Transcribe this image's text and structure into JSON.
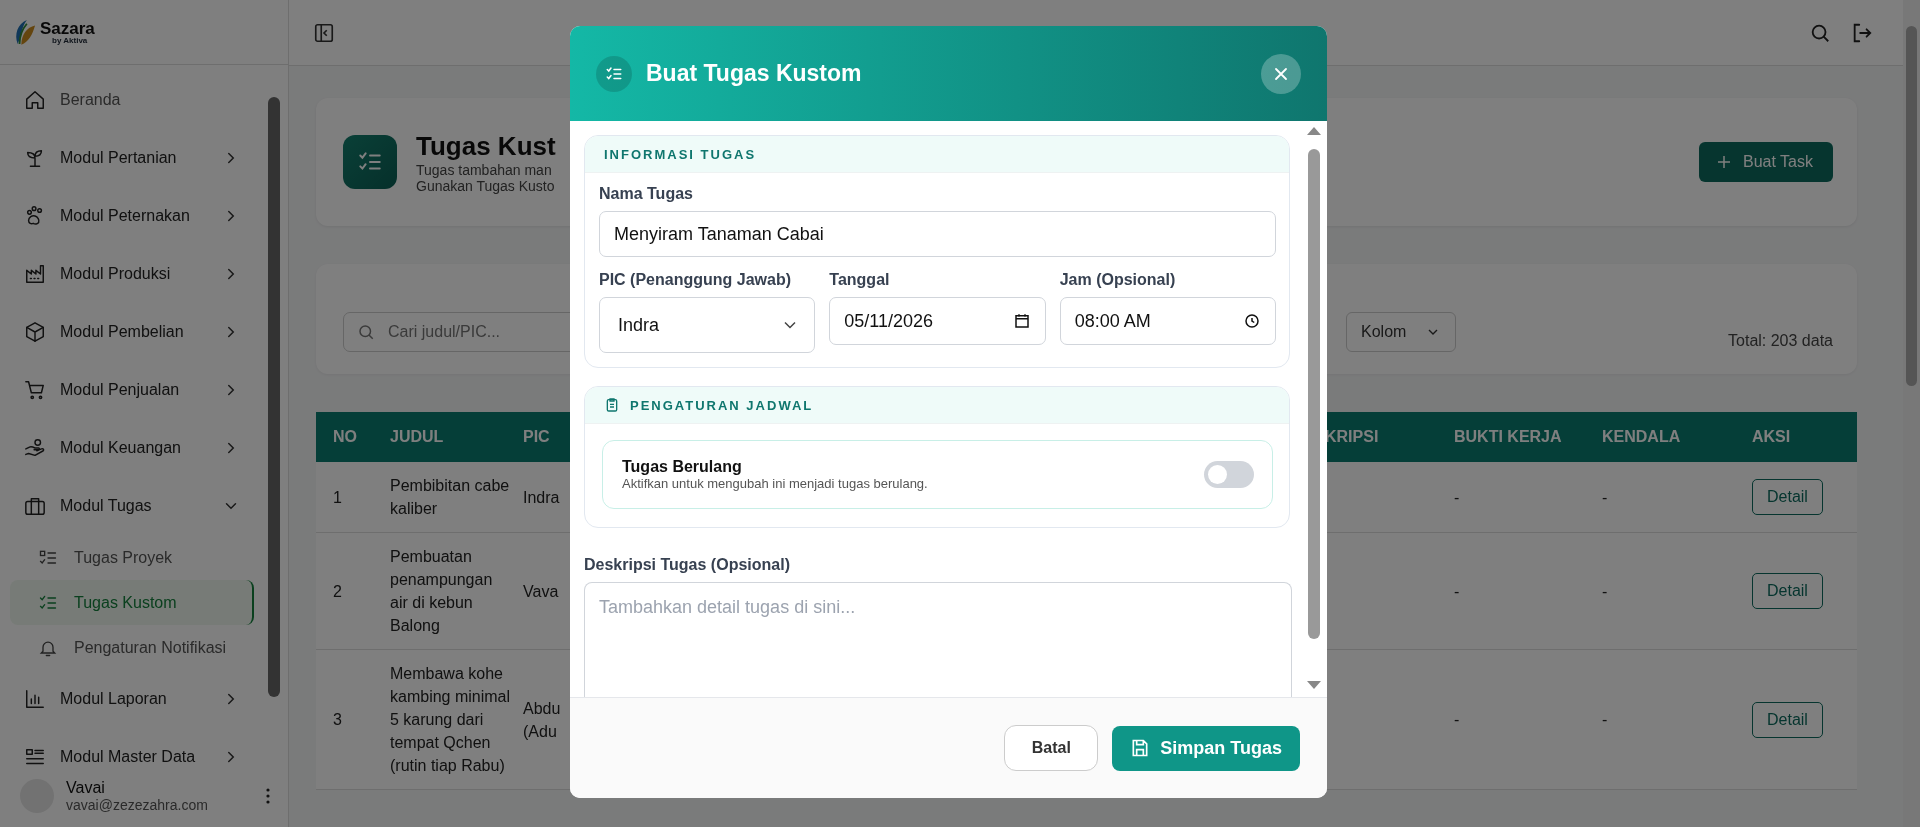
{
  "sidebar": {
    "brand": {
      "name": "Sazara",
      "tagline": "by Aktiva"
    },
    "items": [
      {
        "label": "Beranda"
      },
      {
        "label": "Modul Pertanian",
        "expanded": false
      },
      {
        "label": "Modul Peternakan",
        "expanded": false
      },
      {
        "label": "Modul Produksi",
        "expanded": false
      },
      {
        "label": "Modul Pembelian",
        "expanded": false
      },
      {
        "label": "Modul Penjualan",
        "expanded": false
      },
      {
        "label": "Modul Keuangan",
        "expanded": false
      },
      {
        "label": "Modul Tugas",
        "expanded": true,
        "children": [
          {
            "label": "Tugas Proyek",
            "selected": false
          },
          {
            "label": "Tugas Kustom",
            "selected": true
          },
          {
            "label": "Pengaturan Notifikasi",
            "selected": false
          }
        ]
      },
      {
        "label": "Modul Laporan",
        "expanded": false
      },
      {
        "label": "Modul Master Data",
        "expanded": false
      }
    ],
    "user": {
      "name": "Vavai",
      "email": "vavai@zezezahra.com"
    }
  },
  "page": {
    "title": "Tugas Kust",
    "subtitle_lines": [
      "Tugas tambahan man",
      "Gunakan Tugas Kusto"
    ],
    "create_button": "Buat Task",
    "search": {
      "placeholder": "Cari judul/PIC..."
    },
    "column_menu": "Kolom",
    "total": "Total: 203 data"
  },
  "table": {
    "columns": [
      "NO",
      "JUDUL",
      "PIC",
      "KRIPSI",
      "BUKTI KERJA",
      "KENDALA",
      "AKSI"
    ],
    "rows": [
      {
        "no": "1",
        "title": "Pembibitan cabe kaliber",
        "pic": [
          "Indra"
        ],
        "evidence": "-",
        "issue": "-",
        "action": "Detail"
      },
      {
        "no": "2",
        "title": "Pembuatan penampungan air di kebun Balong",
        "pic": [
          "Vava"
        ],
        "evidence": "-",
        "issue": "-",
        "action": "Detail"
      },
      {
        "no": "3",
        "title": "Membawa kohe kambing minimal 5 karung dari tempat Qchen (rutin tiap Rabu)",
        "pic": [
          "Abdu",
          "(Adu"
        ],
        "evidence": "-",
        "issue": "-",
        "action": "Detail"
      }
    ]
  },
  "dialog": {
    "title": "Buat Tugas Kustom",
    "info_section": {
      "heading": "INFORMASI TUGAS",
      "name_label": "Nama Tugas",
      "name_value": "Menyiram Tanaman Cabai",
      "pic_label": "PIC (Penanggung Jawab)",
      "pic_value": "Indra",
      "date_label": "Tanggal",
      "date_value": "05/11/2026",
      "time_label": "Jam (Opsional)",
      "time_value": "08:00 AM"
    },
    "schedule_section": {
      "heading": "PENGATURAN JADWAL",
      "recurring_title": "Tugas Berulang",
      "recurring_hint": "Aktifkan untuk mengubah ini menjadi tugas berulang.",
      "recurring_on": false
    },
    "description": {
      "label": "Deskripsi Tugas (Opsional)",
      "placeholder": "Tambahkan detail tugas di sini..."
    },
    "buttons": {
      "cancel": "Batal",
      "save": "Simpan Tugas"
    }
  }
}
